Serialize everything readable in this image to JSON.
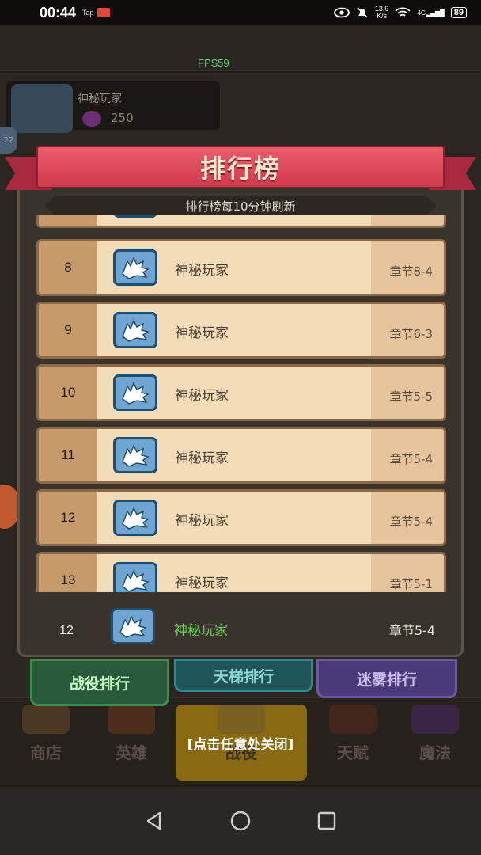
{
  "status_bar": {
    "time": "00:44",
    "app_label": "Tap",
    "net_speed_value": "13.9",
    "net_speed_unit": "K/s",
    "signal_label": "4G",
    "battery": "89"
  },
  "fps": "FPS59",
  "player": {
    "name": "神秘玩家",
    "gems": "250",
    "side_badge": "22"
  },
  "leaderboard": {
    "title": "排行榜",
    "refresh_note": "排行榜每10分钟刷新",
    "rows": [
      {
        "rank": "",
        "name": "",
        "chapter": ""
      },
      {
        "rank": "8",
        "name": "神秘玩家",
        "chapter": "章节8-4"
      },
      {
        "rank": "9",
        "name": "神秘玩家",
        "chapter": "章节6-3"
      },
      {
        "rank": "10",
        "name": "神秘玩家",
        "chapter": "章节5-5"
      },
      {
        "rank": "11",
        "name": "神秘玩家",
        "chapter": "章节5-4"
      },
      {
        "rank": "12",
        "name": "神秘玩家",
        "chapter": "章节5-4"
      },
      {
        "rank": "13",
        "name": "神秘玩家",
        "chapter": "章节5-1"
      }
    ],
    "my_entry": {
      "rank": "12",
      "name": "神秘玩家",
      "chapter": "章节5-4"
    }
  },
  "tabs": [
    "战役排行",
    "天梯排行",
    "迷雾排行"
  ],
  "bottom_nav": [
    "商店",
    "英雄",
    "战役",
    "天赋",
    "魔法"
  ],
  "close_hint": "[点击任意处关闭]",
  "colors": {
    "ribbon": "#d0394d",
    "row_bg": "#f3dcb8",
    "my_name": "#66d44e"
  }
}
